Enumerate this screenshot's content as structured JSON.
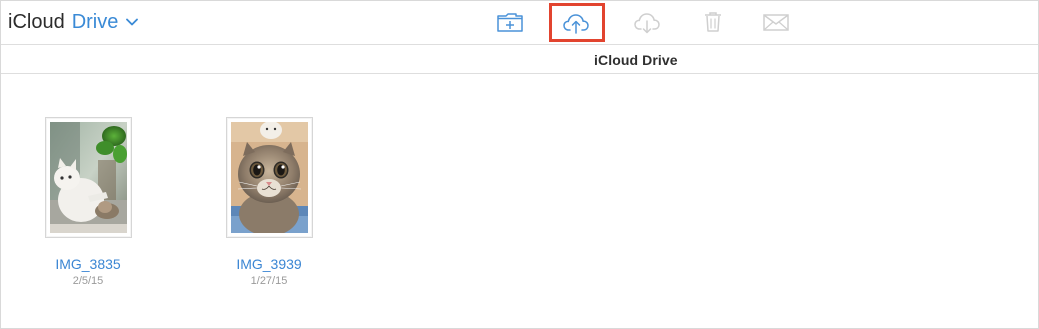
{
  "header": {
    "brand_primary": "iCloud",
    "brand_secondary": "Drive",
    "toolbar": {
      "buttons": [
        {
          "name": "New Folder",
          "icon": "folder-plus-icon",
          "enabled": true
        },
        {
          "name": "Upload",
          "icon": "cloud-upload-icon",
          "enabled": true,
          "highlighted": true
        },
        {
          "name": "Download",
          "icon": "cloud-download-icon",
          "enabled": false
        },
        {
          "name": "Delete",
          "icon": "trash-icon",
          "enabled": false
        },
        {
          "name": "Email",
          "icon": "mail-icon",
          "enabled": false
        }
      ]
    }
  },
  "breadcrumb": {
    "title": "iCloud Drive"
  },
  "files": [
    {
      "name": "IMG_3835",
      "date": "2/5/15"
    },
    {
      "name": "IMG_3939",
      "date": "1/27/15"
    }
  ],
  "colors": {
    "accent": "#3a8ad6",
    "highlight_outline": "#e2442f",
    "disabled_icon": "#cfcfcf",
    "separator": "#dedede"
  }
}
